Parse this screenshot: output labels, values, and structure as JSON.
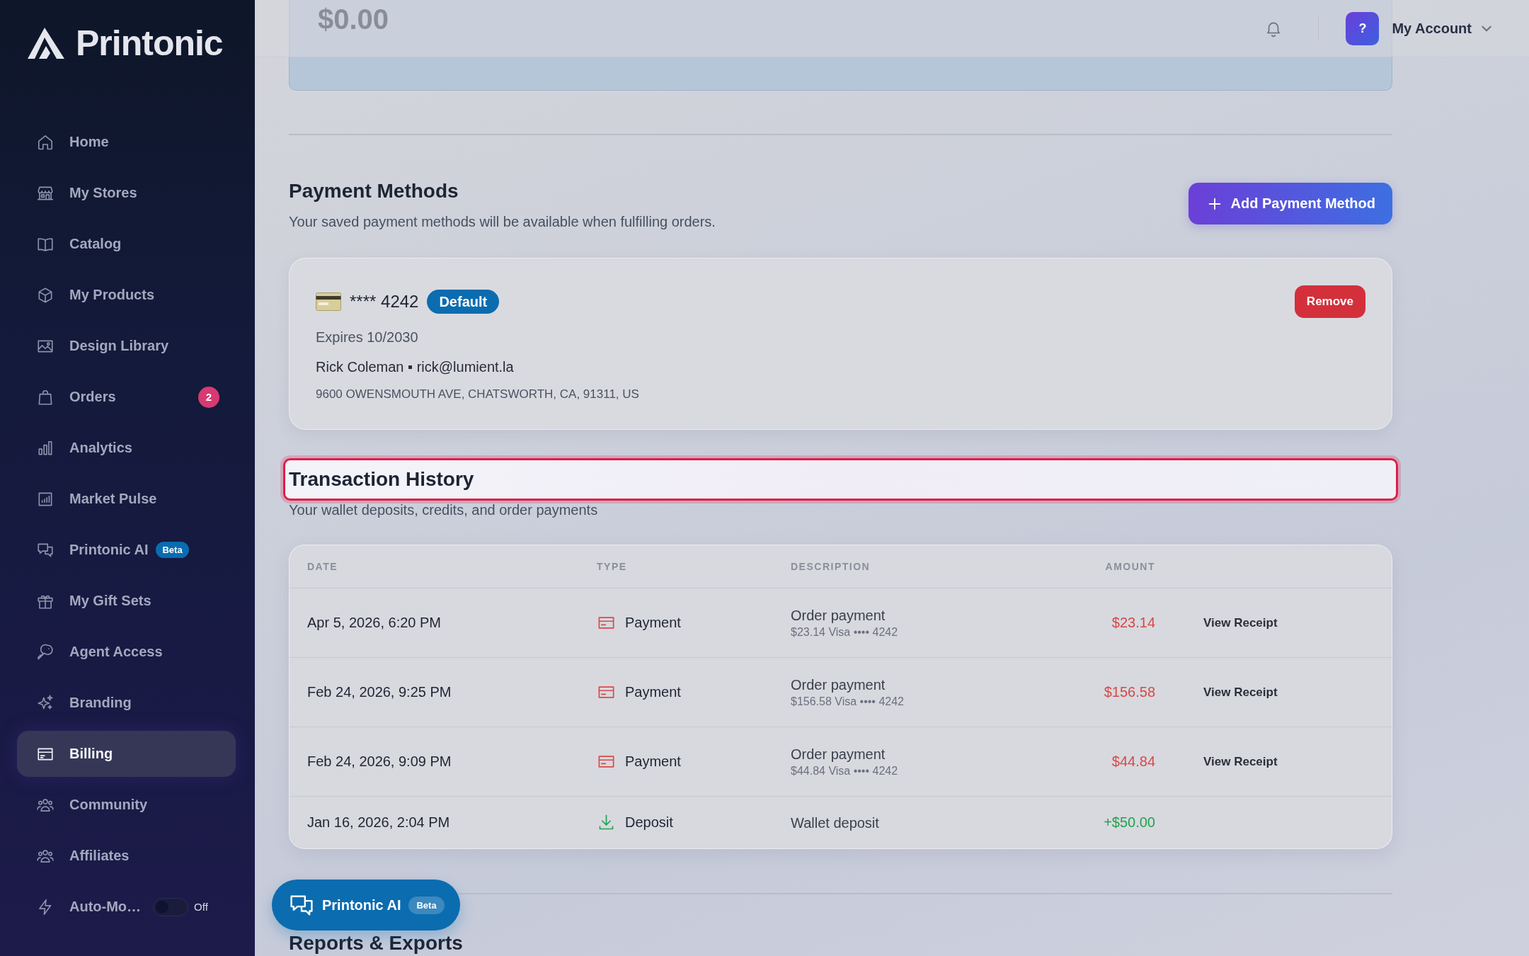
{
  "sidebar": {
    "logo": "Printonic",
    "items": [
      {
        "kind": "link",
        "label": "Home",
        "selected": false
      },
      {
        "kind": "link",
        "label": "My Stores",
        "selected": false
      },
      {
        "kind": "link",
        "label": "Catalog",
        "selected": false
      },
      {
        "kind": "link",
        "label": "My Products",
        "selected": false
      },
      {
        "kind": "link",
        "label": "Design Library",
        "selected": false
      },
      {
        "kind": "link",
        "label": "Orders",
        "selected": false,
        "badge": "2"
      },
      {
        "kind": "link",
        "label": "Analytics",
        "selected": false
      },
      {
        "kind": "link",
        "label": "Market Pulse",
        "selected": false
      },
      {
        "kind": "link",
        "label": "Printonic AI",
        "selected": false,
        "tag": "Beta"
      },
      {
        "kind": "link",
        "label": "My Gift Sets",
        "selected": false
      },
      {
        "kind": "link",
        "label": "Agent Access",
        "selected": false
      },
      {
        "kind": "link",
        "label": "Branding",
        "selected": false
      },
      {
        "kind": "link",
        "label": "Billing",
        "selected": true
      },
      {
        "kind": "link",
        "label": "Community",
        "selected": false
      },
      {
        "kind": "link",
        "label": "Affiliates",
        "selected": false
      },
      {
        "kind": "toggle",
        "label": "Auto-Mo…",
        "selected": false,
        "on": false,
        "state_label": "Off"
      }
    ]
  },
  "header": {
    "avatar": "?",
    "account": "My Account"
  },
  "wallet": {
    "balance": "$0.00"
  },
  "payment_methods": {
    "title": "Payment Methods",
    "subtitle": "Your saved payment methods will be available when fulfilling orders.",
    "add_button": "Add Payment Method",
    "cards": [
      {
        "number": "**** 4242",
        "badge": "Default",
        "expires": "Expires 10/2030",
        "holder": "Rick Coleman ▪ rick@lumient.la",
        "address": "9600 OWENSMOUTH AVE, CHATSWORTH, CA, 91311, US",
        "remove_button": "Remove"
      }
    ]
  },
  "transactions": {
    "title": "Transaction History",
    "highlighted": true,
    "subtitle": "Your wallet deposits, credits, and order payments",
    "columns": [
      "DATE",
      "TYPE",
      "DESCRIPTION",
      "AMOUNT"
    ],
    "rows": [
      {
        "date": "Apr 5, 2026, 6:20 PM",
        "kind": "payment",
        "type": "Payment",
        "description": "Order payment",
        "detail": "$23.14 Visa •••• 4242",
        "amount": "$23.14",
        "action": "View Receipt"
      },
      {
        "date": "Feb 24, 2026, 9:25 PM",
        "kind": "payment",
        "type": "Payment",
        "description": "Order payment",
        "detail": "$156.58 Visa •••• 4242",
        "amount": "$156.58",
        "action": "View Receipt"
      },
      {
        "date": "Feb 24, 2026, 9:09 PM",
        "kind": "payment",
        "type": "Payment",
        "description": "Order payment",
        "detail": "$44.84 Visa •••• 4242",
        "amount": "$44.84",
        "action": "View Receipt"
      },
      {
        "date": "Jan 16, 2026, 2:04 PM",
        "kind": "deposit",
        "type": "Deposit",
        "description": "Wallet deposit",
        "amount": "+$50.00"
      }
    ]
  },
  "reports": {
    "title": "Reports & Exports"
  },
  "assistant_button": {
    "label": "Printonic AI",
    "tag": "Beta"
  }
}
